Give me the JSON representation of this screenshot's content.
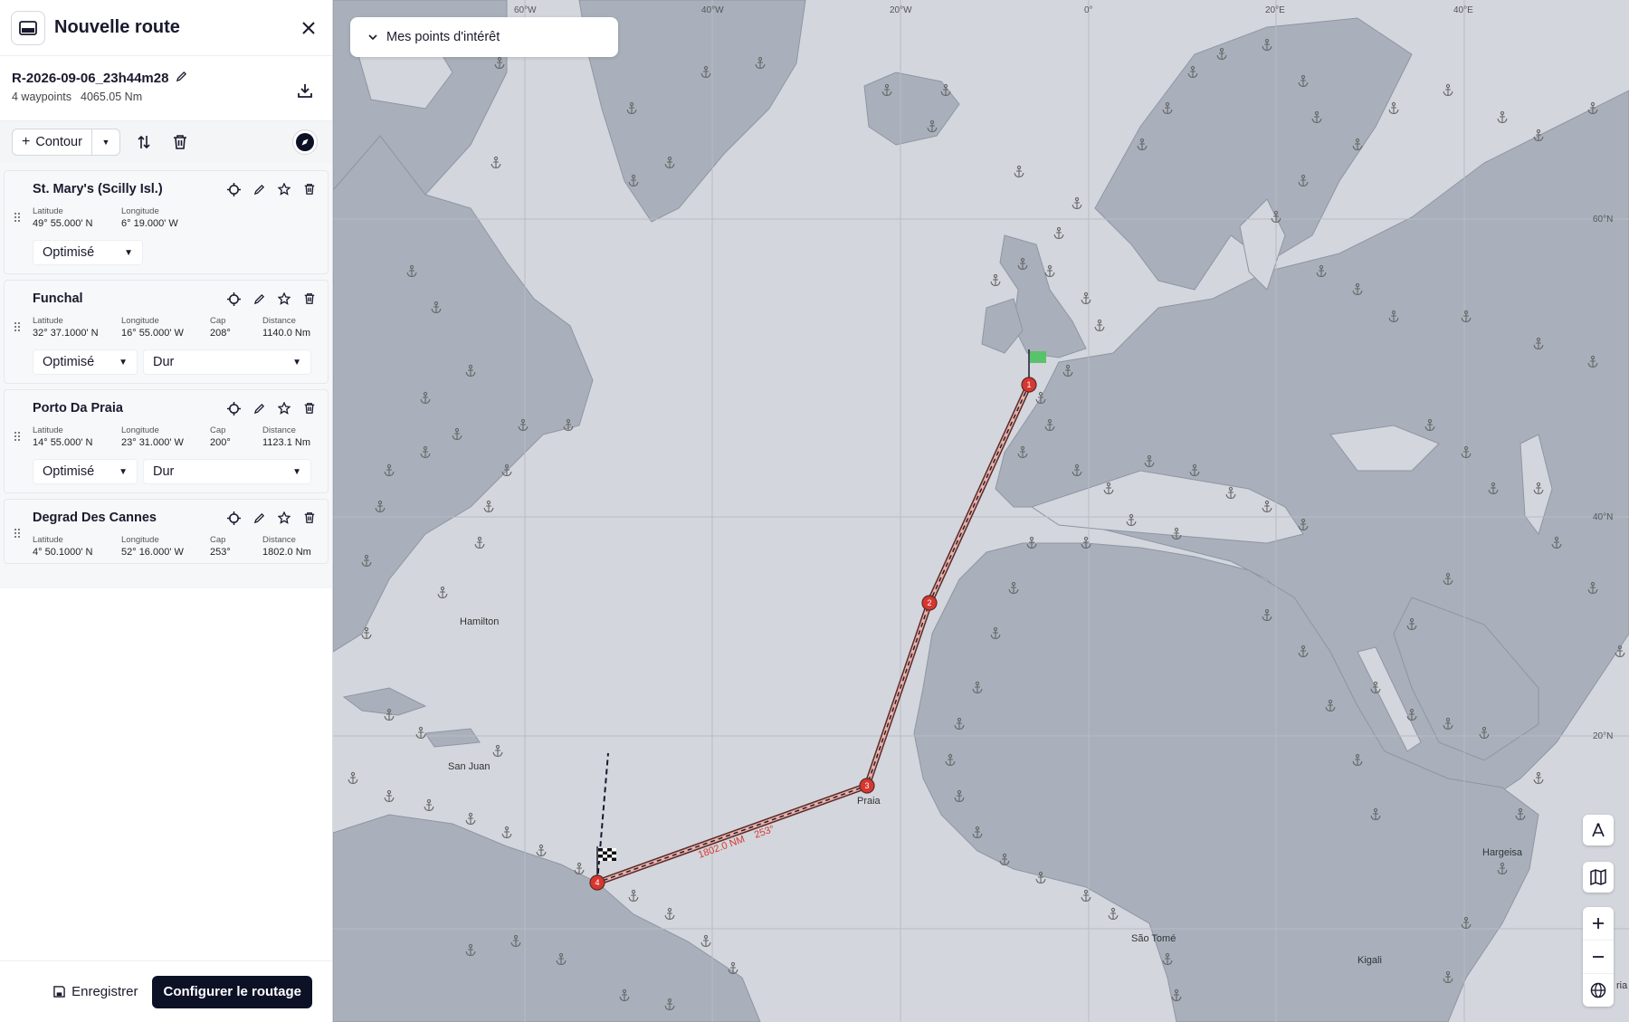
{
  "panel": {
    "title": "Nouvelle route",
    "route_name": "R-2026-09-06_23h44m28",
    "waypoint_count": "4 waypoints",
    "total_distance": "4065.05 Nm",
    "toolbar": {
      "contour_label": "Contour"
    },
    "field_labels": {
      "latitude": "Latitude",
      "longitude": "Longitude",
      "cap": "Cap",
      "distance": "Distance"
    },
    "waypoints": [
      {
        "name": "St. Mary's (Scilly Isl.)",
        "latitude": "49° 55.000' N",
        "longitude": "6° 19.000' W",
        "mode": "Optimisé"
      },
      {
        "name": "Funchal",
        "latitude": "32° 37.1000' N",
        "longitude": "16° 55.000' W",
        "cap": "208°",
        "distance": "1140.0 Nm",
        "mode": "Optimisé",
        "sea": "Dur"
      },
      {
        "name": "Porto Da Praia",
        "latitude": "14° 55.000' N",
        "longitude": "23° 31.000' W",
        "cap": "200°",
        "distance": "1123.1 Nm",
        "mode": "Optimisé",
        "sea": "Dur"
      },
      {
        "name": "Degrad Des Cannes",
        "latitude": "4° 50.1000' N",
        "longitude": "52° 16.000' W",
        "cap": "253°",
        "distance": "1802.0 Nm"
      }
    ],
    "footer": {
      "save_label": "Enregistrer",
      "configure_label": "Configurer le routage"
    }
  },
  "map": {
    "poi_dropdown_label": "Mes points d'intérêt",
    "graticule_lon": [
      "60°W",
      "40°W",
      "20°W",
      "0°",
      "20°E",
      "40°E"
    ],
    "graticule_lat": [
      "60°N",
      "40°N",
      "20°N"
    ],
    "places": [
      "Hamilton",
      "San Juan",
      "Praia",
      "São Tomé",
      "Hargeisa",
      "Kigali",
      "ria"
    ],
    "route_leg_label": "1802.0 NM",
    "route_leg_cap": "253°",
    "waypoint_markers": [
      "1",
      "2",
      "3",
      "4"
    ],
    "colors": {
      "sea": "#d3d6dc",
      "land": "#a9b0bb",
      "route": "#d7372f",
      "button_dark": "#0d1126"
    }
  }
}
